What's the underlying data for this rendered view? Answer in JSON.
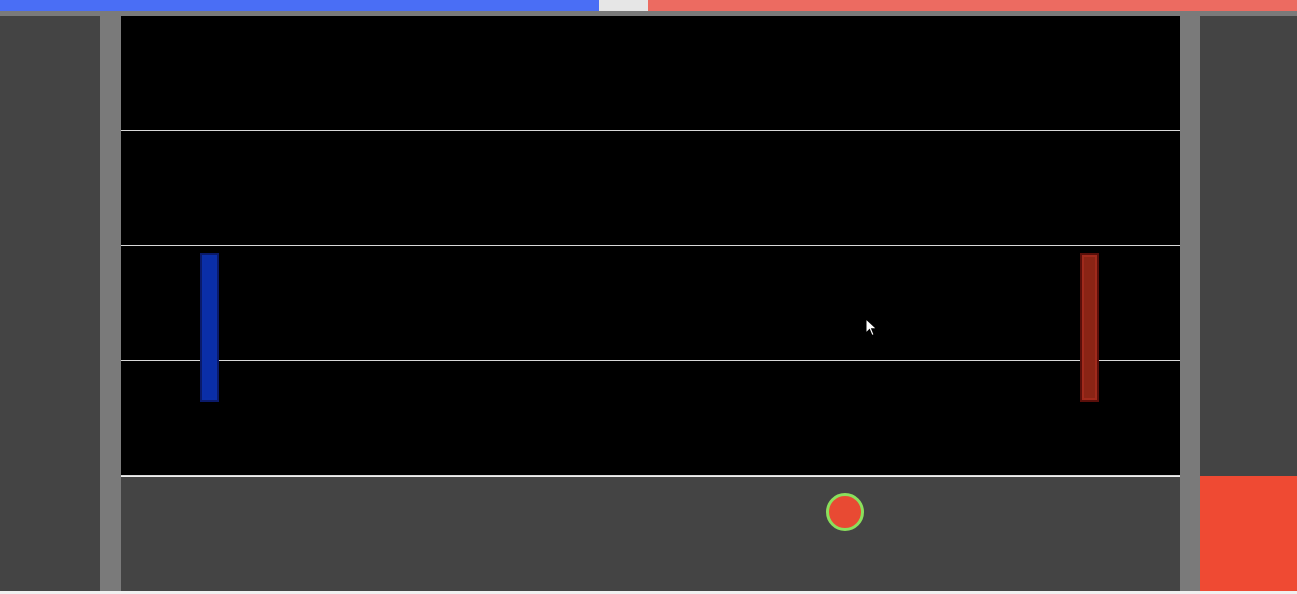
{
  "game": {
    "score_bar": {
      "left_color": "#4a6ef5",
      "right_color": "#ec6b61",
      "left_fraction": 0.462,
      "right_fraction": 0.5
    },
    "players": [
      {
        "side": "left",
        "color": "#0a2ea8"
      },
      {
        "side": "right",
        "color": "#8a2415"
      }
    ],
    "lanes": 4,
    "ball": {
      "fill_color": "#e84a33",
      "ring_color": "#8be05c"
    },
    "right_marker_color": "#ef4a33",
    "cursor_icon": "arrow-cursor-icon"
  }
}
